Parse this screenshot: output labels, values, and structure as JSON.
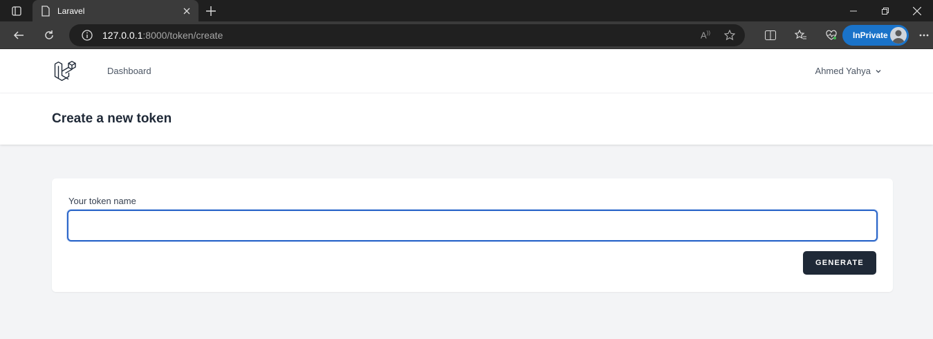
{
  "browser": {
    "tab_title": "Laravel",
    "url_host": "127.0.0.1",
    "url_rest": ":8000/token/create",
    "inprivate_label": "InPrivate"
  },
  "nav": {
    "dashboard_label": "Dashboard",
    "user_name": "Ahmed Yahya"
  },
  "header": {
    "title": "Create a new token"
  },
  "form": {
    "label": "Your token name",
    "value": "",
    "submit_label": "GENERATE"
  },
  "colors": {
    "focus_border": "#2b66c9",
    "button_bg": "#1f2937",
    "inprivate_bg": "#1a73c9"
  }
}
